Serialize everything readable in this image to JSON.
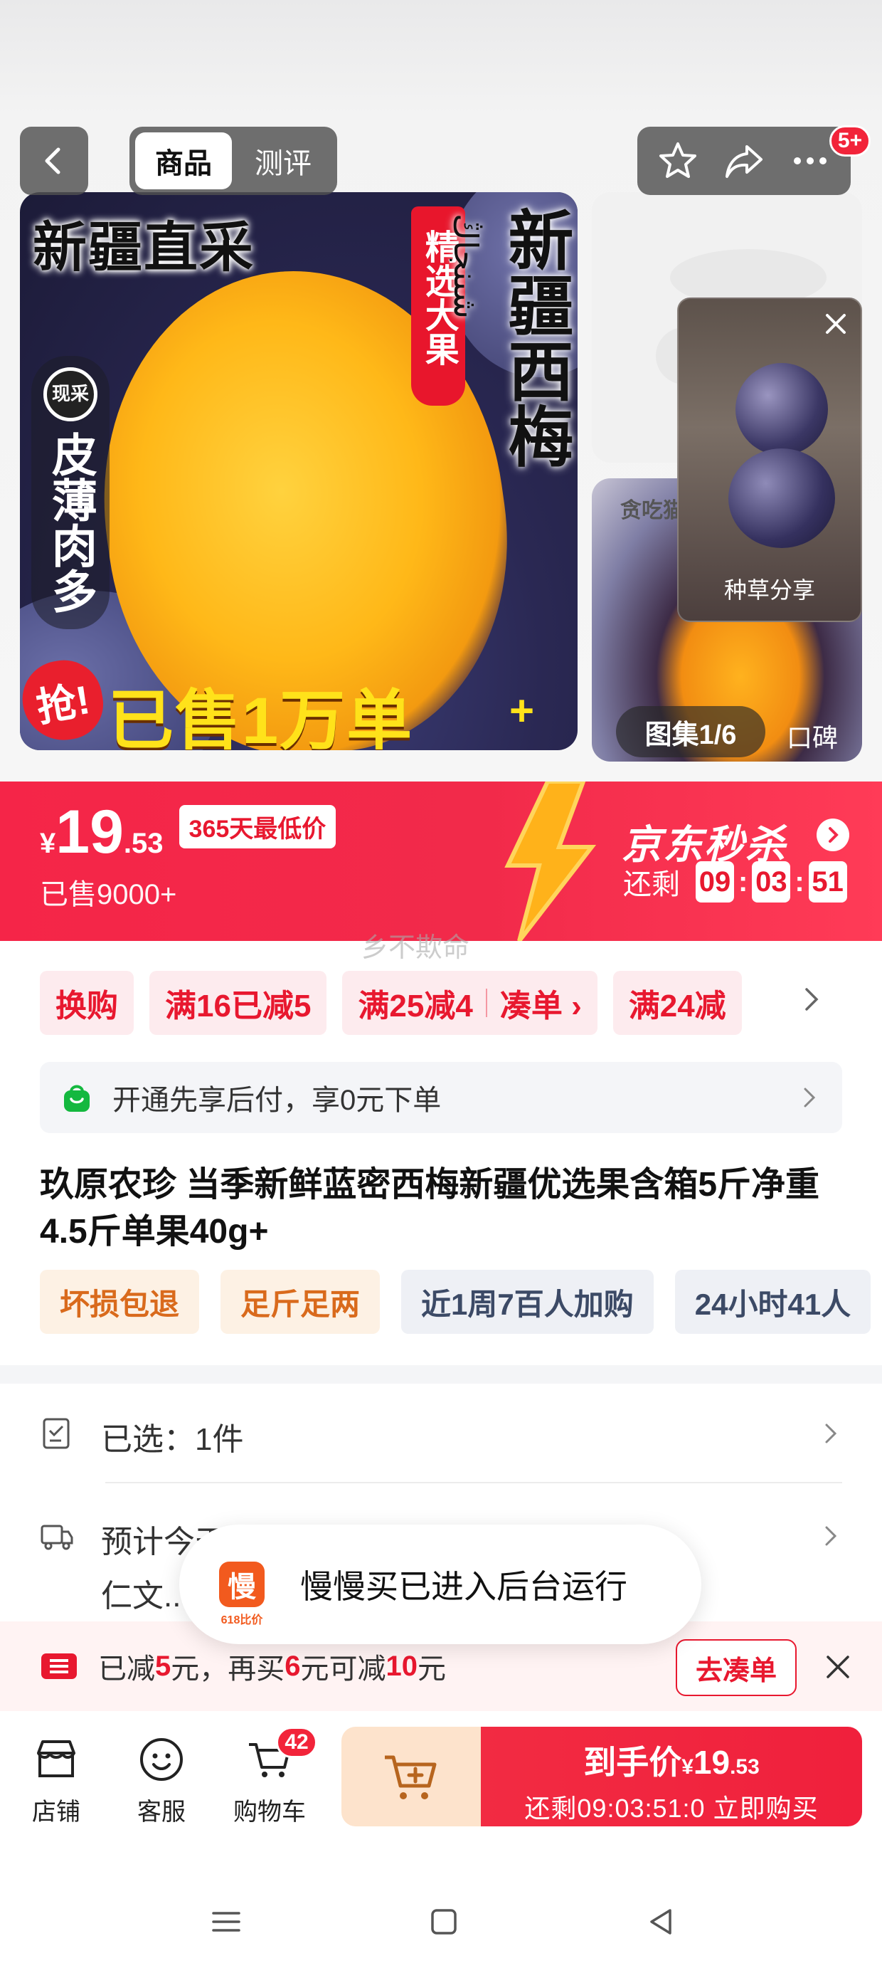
{
  "header": {
    "tabs": [
      {
        "label": "商品",
        "active": true
      },
      {
        "label": "测评",
        "active": false
      }
    ],
    "notification_badge": "5+"
  },
  "gallery": {
    "main_image_texts": {
      "title": "新疆直采",
      "side_title": "新疆西梅",
      "uyghur_text": "شىنجاڭ",
      "ribbon": "精选大果",
      "xiancai": "现采",
      "vertical_label": "皮薄肉多",
      "qiang": "抢!",
      "sold_banner": "已售1万单",
      "sold_plus": "+"
    },
    "second_thumb_label": "贪吃猫",
    "video_label": "种草分享",
    "counter": "图集1/6",
    "koubei": "口碑"
  },
  "seckill": {
    "currency": "¥",
    "price_int": "19",
    "price_dec": ".53",
    "lowest_badge": "365天最低价",
    "sold": "已售9000+",
    "brand": "京东秒杀",
    "countdown_label": "还剩",
    "hh": "09",
    "mm": "03",
    "ss": "51"
  },
  "watermark": "乡不欺命",
  "promos": [
    {
      "label": "换购"
    },
    {
      "label": "满16已减5"
    },
    {
      "label": "满25减4",
      "extra": "凑单 ›"
    },
    {
      "label": "满24减"
    }
  ],
  "pay_bar": {
    "text": "开通先享后付，享0元下单"
  },
  "product": {
    "title": "玖原农珍 当季新鲜蓝密西梅新疆优选果含箱5斤净重4.5斤单果40g+",
    "tags": [
      {
        "label": "坏损包退",
        "style": "warm"
      },
      {
        "label": "足斤足两",
        "style": "warm"
      },
      {
        "label": "近1周7百人加购",
        "style": "cool"
      },
      {
        "label": "24小时41人",
        "style": "cool"
      }
    ]
  },
  "options": {
    "selected": "已选：1件",
    "delivery_line1": "预计今天发货，后天送达",
    "delivery_line2": "仁文..."
  },
  "toast": {
    "app_glyph": "慢",
    "app_caption": "618比价",
    "message": "慢慢买已进入后台运行"
  },
  "coupon_bar": {
    "prefix": "已减",
    "amount1": "5",
    "mid1": "元，再买",
    "amount2": "6",
    "mid2": "元可减",
    "amount3": "10",
    "suffix": "元",
    "button": "去凑单"
  },
  "action_bar": {
    "store": "店铺",
    "service": "客服",
    "cart": "购物车",
    "cart_count": "42",
    "buy_label": "到手价",
    "buy_currency": "¥",
    "buy_price_int": "19",
    "buy_price_dec": ".53",
    "buy_sub": "还剩09:03:51:0 立即购买"
  },
  "colors": {
    "brand_red": "#f2243a",
    "tag_warm": "#d96a1c",
    "tag_cool": "#3c4a66",
    "add_cart_bg": "#fde3cc"
  }
}
